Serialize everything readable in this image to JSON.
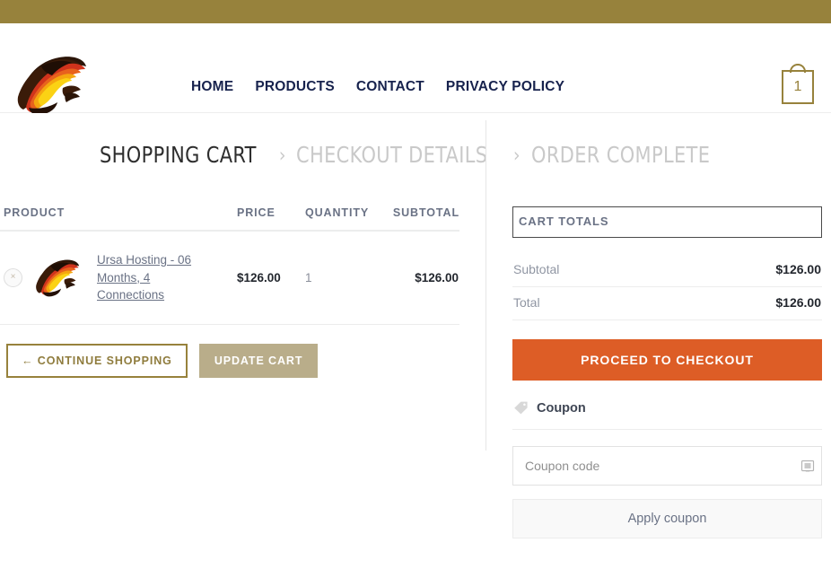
{
  "theme": {
    "topbar_color": "#97823c",
    "accent_gold": "#97823c",
    "checkout_orange": "#dd5d26",
    "update_tan": "#b9ad8a",
    "nav_navy": "#17224d",
    "muted_text": "#6a7285"
  },
  "header": {
    "logo_name": "site-logo",
    "nav": [
      {
        "label": "HOME"
      },
      {
        "label": "PRODUCTS"
      },
      {
        "label": "CONTACT"
      },
      {
        "label": "PRIVACY POLICY"
      }
    ],
    "cart": {
      "icon": "shopping-bag-icon",
      "count": "1"
    }
  },
  "steps": [
    {
      "label": "SHOPPING CART",
      "state": "current"
    },
    {
      "label": "CHECKOUT DETAILS",
      "state": "upcoming"
    },
    {
      "label": "ORDER COMPLETE",
      "state": "upcoming"
    }
  ],
  "step_separator": "›",
  "cart": {
    "columns": {
      "product": "PRODUCT",
      "price": "PRICE",
      "quantity": "QUANTITY",
      "subtotal": "SUBTOTAL"
    },
    "items": [
      {
        "remove_icon": "remove-x-icon",
        "remove_label": "×",
        "thumbnail": "product-thumbnail",
        "name": "Ursa Hosting - 06 Months, 4 Connections",
        "price": "$126.00",
        "quantity": "1",
        "subtotal": "$126.00"
      }
    ],
    "actions": {
      "continue_shopping": "← CONTINUE SHOPPING",
      "update_cart": "UPDATE CART"
    }
  },
  "totals": {
    "title": "CART TOTALS",
    "rows": [
      {
        "label": "Subtotal",
        "value": "$126.00"
      },
      {
        "label": "Total",
        "value": "$126.00"
      }
    ],
    "checkout_button": "PROCEED TO CHECKOUT"
  },
  "coupon": {
    "icon": "tag-icon",
    "heading": "Coupon",
    "input_value": "",
    "input_placeholder": "Coupon code",
    "autofill_icon": "form-autofill-icon",
    "apply_button": "Apply coupon"
  }
}
